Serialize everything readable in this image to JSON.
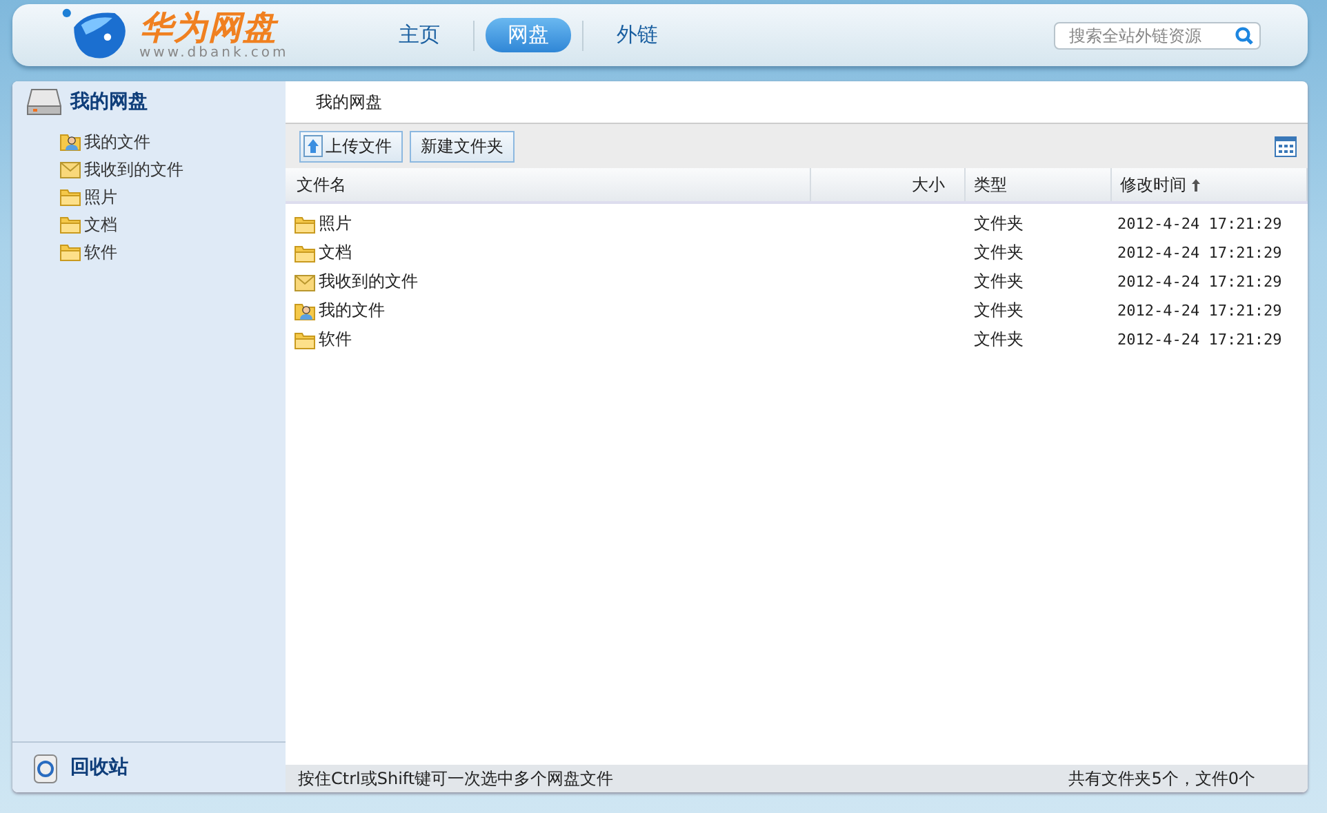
{
  "logo": {
    "name": "华为网盘",
    "url": "www.dbank.com"
  },
  "nav": [
    {
      "label": "主页",
      "selected": false
    },
    {
      "label": "网盘",
      "selected": true
    },
    {
      "label": "外链",
      "selected": false
    }
  ],
  "search": {
    "placeholder": "搜索全站外链资源"
  },
  "sidebar": {
    "title": "我的网盘",
    "items": [
      {
        "label": "我的文件",
        "kind": "user"
      },
      {
        "label": "我收到的文件",
        "kind": "mail"
      },
      {
        "label": "照片",
        "kind": "folder"
      },
      {
        "label": "文档",
        "kind": "folder"
      },
      {
        "label": "软件",
        "kind": "folder"
      }
    ],
    "recycle": "回收站"
  },
  "breadcrumb": "我的网盘",
  "toolbar": {
    "buttons": [
      {
        "label": "上传文件",
        "kind": "upload"
      },
      {
        "label": "新建文件夹",
        "kind": "plain"
      }
    ]
  },
  "table": {
    "columns": [
      {
        "label": "文件名",
        "sorted": false
      },
      {
        "label": "大小",
        "sorted": false
      },
      {
        "label": "类型",
        "sorted": false
      },
      {
        "label": "修改时间",
        "sorted": true
      }
    ],
    "rows": [
      {
        "name": "照片",
        "kind": "folder",
        "type": "文件夹",
        "modified": "2012-4-24 17:21:29"
      },
      {
        "name": "文档",
        "kind": "folder",
        "type": "文件夹",
        "modified": "2012-4-24 17:21:29"
      },
      {
        "name": "我收到的文件",
        "kind": "mail",
        "type": "文件夹",
        "modified": "2012-4-24 17:21:29"
      },
      {
        "name": "我的文件",
        "kind": "user",
        "type": "文件夹",
        "modified": "2012-4-24 17:21:29"
      },
      {
        "name": "软件",
        "kind": "folder",
        "type": "文件夹",
        "modified": "2012-4-24 17:21:29"
      }
    ]
  },
  "status_bar": {
    "hint": "按住Ctrl或Shift键可一次选中多个网盘文件",
    "summary": "共有文件夹5个，文件0个"
  }
}
